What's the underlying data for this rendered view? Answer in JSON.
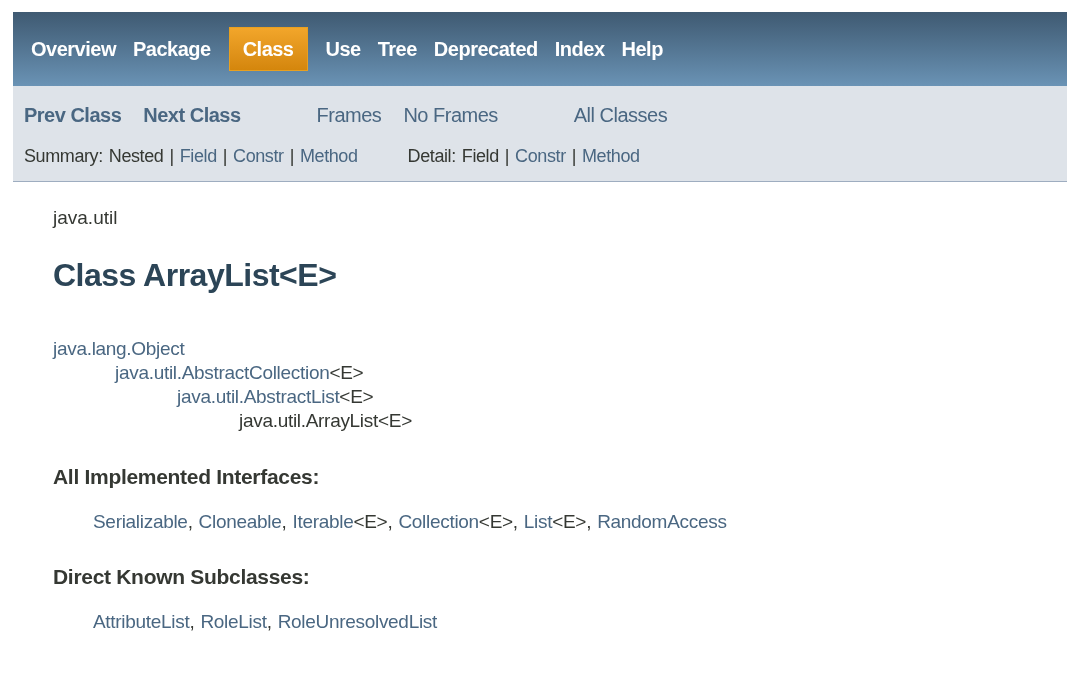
{
  "top_nav": [
    {
      "label": "Overview",
      "selected": false
    },
    {
      "label": "Package",
      "selected": false
    },
    {
      "label": "Class",
      "selected": true
    },
    {
      "label": "Use",
      "selected": false
    },
    {
      "label": "Tree",
      "selected": false
    },
    {
      "label": "Deprecated",
      "selected": false
    },
    {
      "label": "Index",
      "selected": false
    },
    {
      "label": "Help",
      "selected": false
    }
  ],
  "sub_nav": {
    "groups": [
      [
        {
          "label": "Prev Class",
          "bold": true
        },
        {
          "label": "Next Class",
          "bold": true
        }
      ],
      [
        {
          "label": "Frames",
          "bold": false
        },
        {
          "label": "No Frames",
          "bold": false
        }
      ],
      [
        {
          "label": "All Classes",
          "bold": false
        }
      ]
    ],
    "summary": {
      "label": "Summary:",
      "items": [
        {
          "label": "Nested",
          "link": false
        },
        {
          "sep": "|",
          "label": "Field",
          "link": true
        },
        {
          "sep": "|",
          "label": "Constr",
          "link": true
        },
        {
          "sep": "|",
          "label": "Method",
          "link": true
        }
      ]
    },
    "detail": {
      "label": "Detail:",
      "items": [
        {
          "label": "Field",
          "link": false
        },
        {
          "sep": "|",
          "label": "Constr",
          "link": true
        },
        {
          "sep": "|",
          "label": "Method",
          "link": true
        }
      ]
    }
  },
  "package": "java.util",
  "title": "Class ArrayList<E>",
  "hierarchy": [
    {
      "name": "java.lang.Object",
      "link": true,
      "children": [
        {
          "name": "java.util.AbstractCollection",
          "suffix": "<E>",
          "link": true,
          "children": [
            {
              "name": "java.util.AbstractList",
              "suffix": "<E>",
              "link": true,
              "children": [
                {
                  "name": "java.util.ArrayList",
                  "suffix": "<E>",
                  "link": false
                }
              ]
            }
          ]
        }
      ]
    }
  ],
  "sections": [
    {
      "heading": "All Implemented Interfaces:",
      "items": [
        {
          "name": "Serializable",
          "after": ","
        },
        {
          "name": "Cloneable",
          "after": ","
        },
        {
          "name": "Iterable",
          "suffix": "<E>",
          "after": ","
        },
        {
          "name": "Collection",
          "suffix": "<E>",
          "after": ","
        },
        {
          "name": "List",
          "suffix": "<E>",
          "after": ","
        },
        {
          "name": "RandomAccess"
        }
      ]
    },
    {
      "heading": "Direct Known Subclasses:",
      "items": [
        {
          "name": "AttributeList",
          "after": ","
        },
        {
          "name": "RoleList",
          "after": ","
        },
        {
          "name": "RoleUnresolvedList"
        }
      ]
    }
  ]
}
